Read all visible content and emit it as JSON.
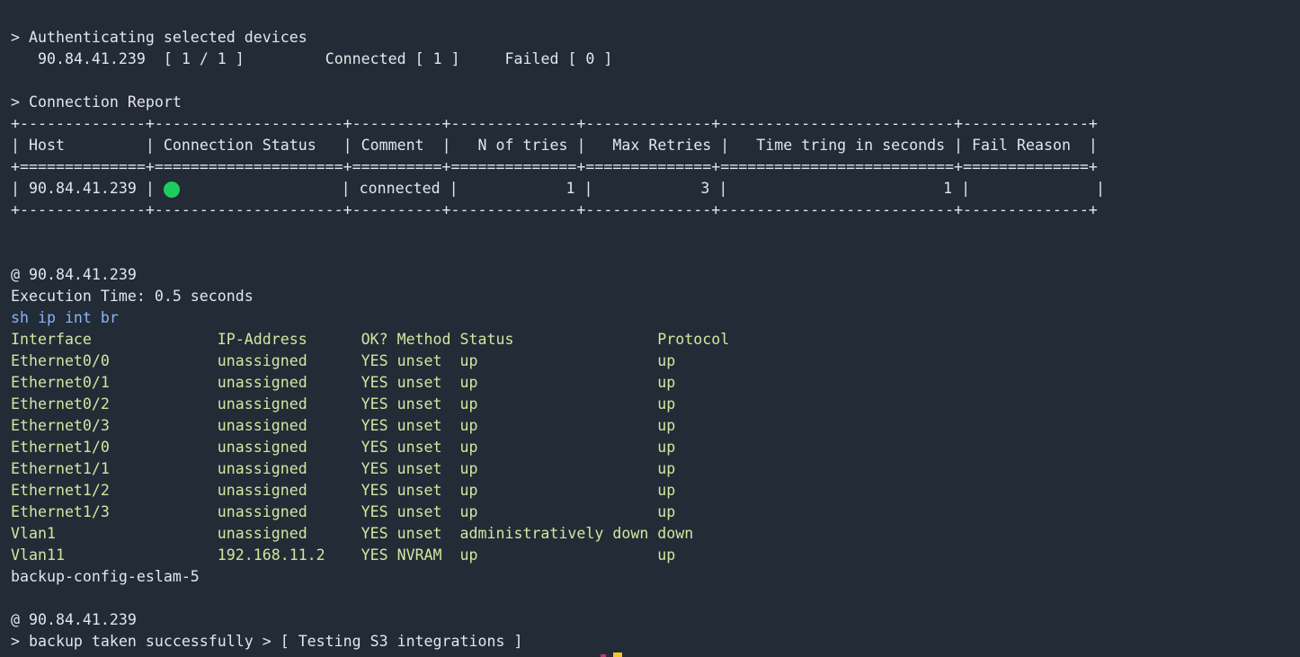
{
  "auth": {
    "heading": "> Authenticating selected devices",
    "host": "90.84.41.239",
    "progress": "[ 1 / 1 ]",
    "connected": "Connected [ 1 ]",
    "failed": "Failed [ 0 ]"
  },
  "report": {
    "heading": "> Connection Report",
    "border": "+--------------+---------------------+----------+--------------+--------------+--------------------------+--------------+",
    "double_border": "+==============+=====================+==========+==============+==============+==========================+==============+",
    "columns": [
      "Host",
      "Connection Status",
      "Comment",
      "N of tries",
      "Max Retries",
      "Time tring in seconds",
      "Fail Reason"
    ],
    "rows": [
      {
        "host": "90.84.41.239",
        "status": "connected-dot",
        "comment": "connected",
        "tries": "1",
        "max_retries": "3",
        "time": "1",
        "fail_reason": ""
      }
    ],
    "status_color": "#1ccd5e"
  },
  "session1": {
    "at_host": "@ 90.84.41.239",
    "exec_time": "Execution Time: 0.5 seconds",
    "command": "sh ip int br",
    "header": "Interface              IP-Address      OK? Method Status                Protocol",
    "lines": [
      "Ethernet0/0            unassigned      YES unset  up                    up",
      "Ethernet0/1            unassigned      YES unset  up                    up",
      "Ethernet0/2            unassigned      YES unset  up                    up",
      "Ethernet0/3            unassigned      YES unset  up                    up",
      "Ethernet1/0            unassigned      YES unset  up                    up",
      "Ethernet1/1            unassigned      YES unset  up                    up",
      "Ethernet1/2            unassigned      YES unset  up                    up",
      "Ethernet1/3            unassigned      YES unset  up                    up",
      "Vlan1                  unassigned      YES unset  administratively down down",
      "Vlan11                 192.168.11.2    YES NVRAM  up                    up"
    ],
    "backup_name": "backup-config-eslam-5"
  },
  "session2": {
    "at_host": "@ 90.84.41.239",
    "message": "> backup taken successfully > [ Testing S3 integrations ]"
  },
  "colors": {
    "background": "#232b36",
    "text": "#e3e6ea",
    "output_green": "#cfe8a0",
    "command_blue": "#8ab4f8"
  }
}
